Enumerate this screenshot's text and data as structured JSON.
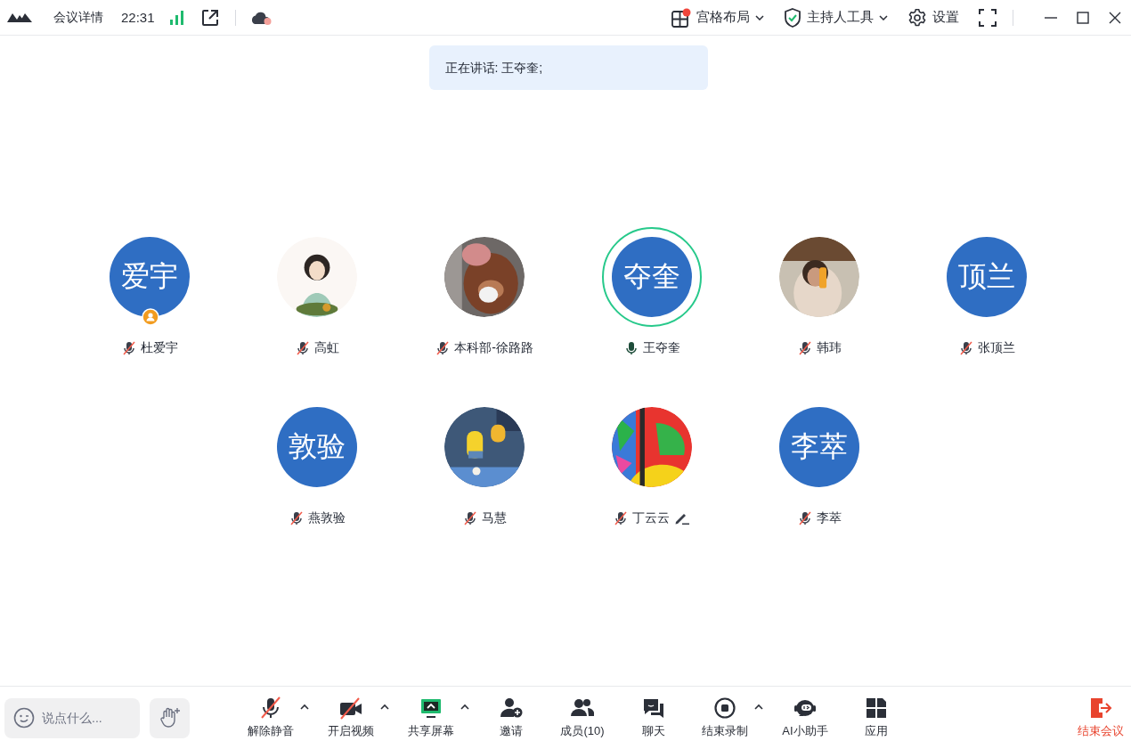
{
  "title_bar": {
    "title": "会议详情",
    "time": "22:31",
    "cloud_alert": true,
    "layout": {
      "label": "宫格布局",
      "alert": true
    },
    "host_tools": {
      "label": "主持人工具"
    },
    "settings": {
      "label": "设置"
    }
  },
  "speaking_banner": "正在讲话: 王夺奎;",
  "participants": [
    {
      "name": "杜爱宇",
      "avatar": {
        "kind": "initials",
        "text": "爱宇"
      },
      "muted": true,
      "speaking": false,
      "host_badge": true,
      "annotating": false
    },
    {
      "name": "高虹",
      "muted": true,
      "speaking": false,
      "host_badge": false,
      "annotating": false
    },
    {
      "name": "本科部-徐路路",
      "muted": true,
      "speaking": false,
      "host_badge": false,
      "annotating": false
    },
    {
      "name": "王夺奎",
      "avatar": {
        "kind": "initials",
        "text": "夺奎"
      },
      "muted": false,
      "speaking": true,
      "host_badge": false,
      "annotating": false
    },
    {
      "name": "韩玮",
      "muted": true,
      "speaking": false,
      "host_badge": false,
      "annotating": false
    },
    {
      "name": "张顶兰",
      "avatar": {
        "kind": "initials",
        "text": "顶兰"
      },
      "muted": true,
      "speaking": false,
      "host_badge": false,
      "annotating": false
    },
    {
      "name": "燕敦验",
      "avatar": {
        "kind": "initials",
        "text": "敦验"
      },
      "muted": true,
      "speaking": false,
      "host_badge": false,
      "annotating": false
    },
    {
      "name": "马慧",
      "muted": true,
      "speaking": false,
      "host_badge": false,
      "annotating": false
    },
    {
      "name": "丁云云",
      "muted": true,
      "speaking": false,
      "host_badge": false,
      "annotating": true
    },
    {
      "name": "李萃",
      "avatar": {
        "kind": "initials",
        "text": "李萃"
      },
      "muted": true,
      "speaking": false,
      "host_badge": false,
      "annotating": false
    }
  ],
  "chat_input": {
    "placeholder": "说点什么..."
  },
  "toolbar": [
    {
      "kind": "mic",
      "label": "解除静音",
      "caret": true
    },
    {
      "kind": "video",
      "label": "开启视频",
      "caret": true
    },
    {
      "kind": "share",
      "label": "共享屏幕",
      "caret": true
    },
    {
      "kind": "invite",
      "label": "邀请",
      "caret": false
    },
    {
      "kind": "members",
      "label": "成员(10)",
      "caret": false
    },
    {
      "kind": "chat",
      "label": "聊天",
      "caret": false
    },
    {
      "kind": "record",
      "label": "结束录制",
      "caret": true
    },
    {
      "kind": "assistant",
      "label": "AI小助手",
      "caret": false
    },
    {
      "kind": "apps",
      "label": "应用",
      "caret": false
    }
  ],
  "end_meeting": "结束会议"
}
